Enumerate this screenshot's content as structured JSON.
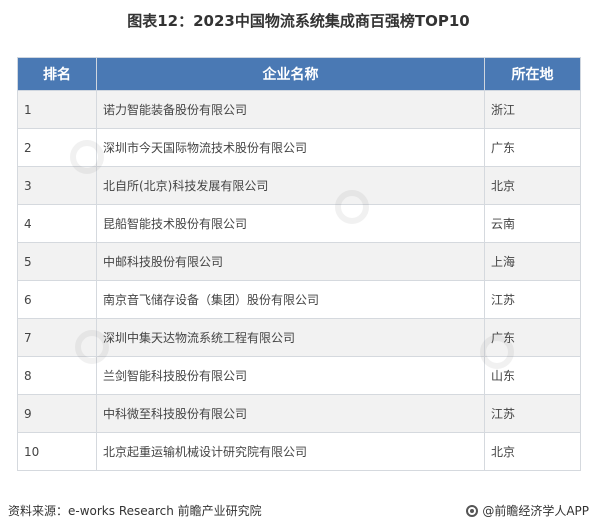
{
  "title": "图表12：2023中国物流系统集成商百强榜TOP10",
  "table": {
    "headers": [
      "排名",
      "企业名称",
      "所在地"
    ],
    "rows": [
      {
        "rank": "1",
        "name": "诺力智能装备股份有限公司",
        "location": "浙江"
      },
      {
        "rank": "2",
        "name": "深圳市今天国际物流技术股份有限公司",
        "location": "广东"
      },
      {
        "rank": "3",
        "name": "北自所(北京)科技发展有限公司",
        "location": "北京"
      },
      {
        "rank": "4",
        "name": "昆船智能技术股份有限公司",
        "location": "云南"
      },
      {
        "rank": "5",
        "name": "中邮科技股份有限公司",
        "location": "上海"
      },
      {
        "rank": "6",
        "name": "南京音飞储存设备（集团）股份有限公司",
        "location": "江苏"
      },
      {
        "rank": "7",
        "name": "深圳中集天达物流系统工程有限公司",
        "location": "广东"
      },
      {
        "rank": "8",
        "name": "兰剑智能科技股份有限公司",
        "location": "山东"
      },
      {
        "rank": "9",
        "name": "中科微至科技股份有限公司",
        "location": "江苏"
      },
      {
        "rank": "10",
        "name": "北京起重运输机械设计研究院有限公司",
        "location": "北京"
      }
    ]
  },
  "footer": {
    "source": "资料来源：e-works Research 前瞻产业研究院",
    "app": "@前瞻经济学人APP"
  },
  "colors": {
    "header_bg": "#4a79b4",
    "stripe_bg": "#f2f2f2"
  }
}
